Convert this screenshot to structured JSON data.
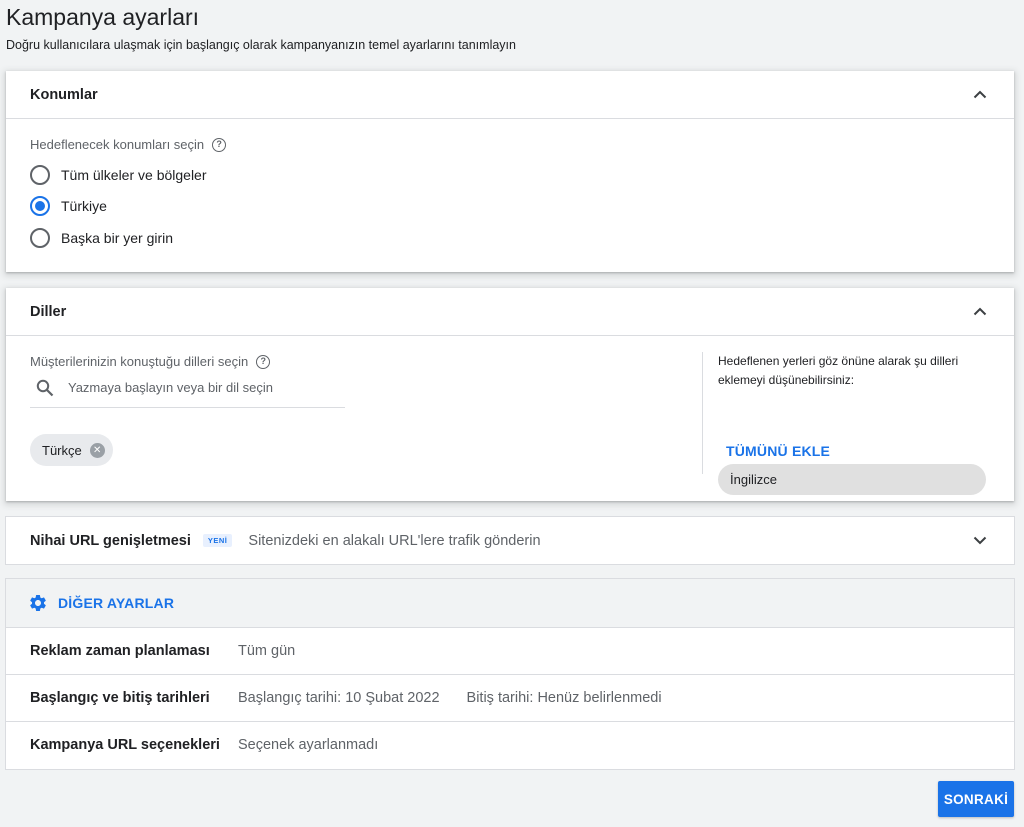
{
  "page": {
    "title": "Kampanya ayarları",
    "subtitle": "Doğru kullanıcılara ulaşmak için başlangıç olarak kampanyanızın temel ayarlarını tanımlayın"
  },
  "locations": {
    "title": "Konumlar",
    "field_label": "Hedeflenecek konumları seçin",
    "options": [
      "Tüm ülkeler ve bölgeler",
      "Türkiye",
      "Başka bir yer girin"
    ],
    "selected": "Türkiye"
  },
  "languages": {
    "title": "Diller",
    "field_label": "Müşterilerinizin konuştuğu dilleri seçin",
    "search_placeholder": "Yazmaya başlayın veya bir dil seçin",
    "selected_chip": "Türkçe",
    "suggestion_text": "Hedeflenen yerleri göz önüne alarak şu dilleri eklemeyi düşünebilirsiniz:",
    "suggested": "İngilizce",
    "add_all_label": "TÜMÜNÜ EKLE"
  },
  "final_url": {
    "title": "Nihai URL genişletmesi",
    "badge": "YENİ",
    "description": "Sitenizdeki en alakalı URL'lere trafik gönderin"
  },
  "other_settings": {
    "title": "DİĞER AYARLAR",
    "rows": [
      {
        "label": "Reklam zaman planlaması",
        "values": [
          "Tüm gün"
        ]
      },
      {
        "label": "Başlangıç ve bitiş tarihleri",
        "values": [
          "Başlangıç tarihi: 10 Şubat 2022",
          "Bitiş tarihi: Henüz belirlenmedi"
        ]
      },
      {
        "label": "Kampanya URL seçenekleri",
        "values": [
          "Seçenek ayarlanmadı"
        ]
      }
    ]
  },
  "next_button": "SONRAKİ",
  "colors": {
    "accent": "#1a73e8",
    "background": "#f1f3f4",
    "text_secondary": "#5f6368"
  }
}
